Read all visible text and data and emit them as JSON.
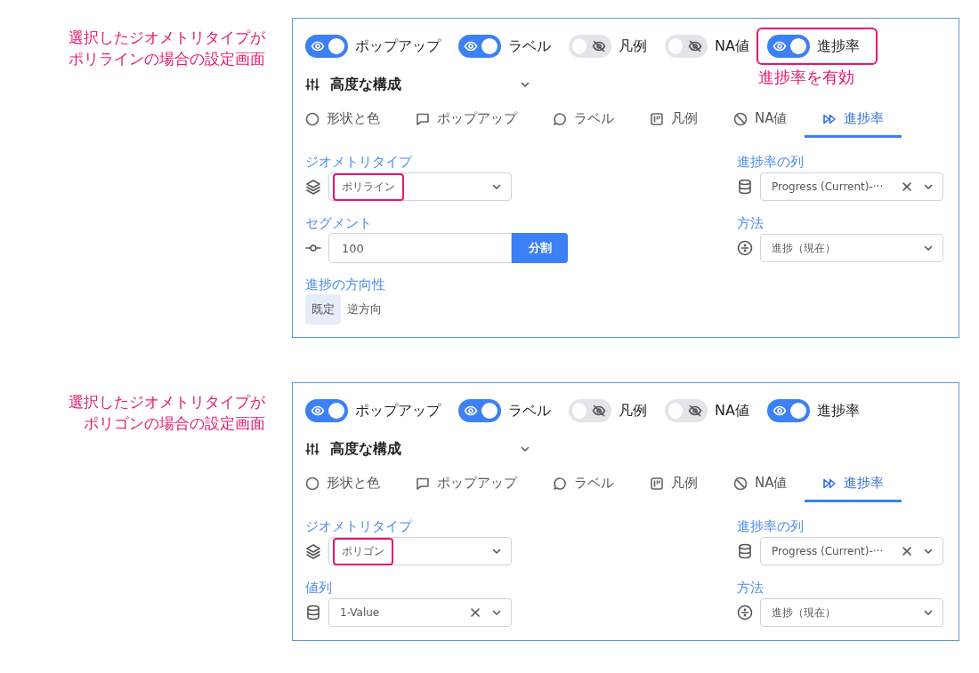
{
  "panels": [
    {
      "caption_lines": [
        "選択したジオメトリタイプが",
        "ポリラインの場合の設定画面"
      ],
      "toggles": [
        {
          "label": "ポップアップ",
          "on": true,
          "highlighted": false
        },
        {
          "label": "ラベル",
          "on": true,
          "highlighted": false
        },
        {
          "label": "凡例",
          "on": false,
          "highlighted": false
        },
        {
          "label": "NA値",
          "on": false,
          "highlighted": false
        },
        {
          "label": "進捗率",
          "on": true,
          "highlighted": true,
          "callout": "進捗率を有効"
        }
      ],
      "advanced": {
        "label": "高度な構成"
      },
      "tabs": [
        {
          "label": "形状と色",
          "selected": false
        },
        {
          "label": "ポップアップ",
          "selected": false
        },
        {
          "label": "ラベル",
          "selected": false
        },
        {
          "label": "凡例",
          "selected": false
        },
        {
          "label": "NA値",
          "selected": false
        },
        {
          "label": "進捗率",
          "selected": true
        }
      ],
      "left_fields": [
        {
          "kind": "geometry",
          "label": "ジオメトリタイプ",
          "value": "ポリライン",
          "clearable": false,
          "highlighted": true
        },
        {
          "kind": "number",
          "label": "セグメント",
          "value": "100",
          "button": "分割"
        },
        {
          "kind": "segmented",
          "label": "進捗の方向性",
          "options": [
            {
              "label": "既定",
              "selected": true
            },
            {
              "label": "逆方向",
              "selected": false
            }
          ]
        }
      ],
      "right_fields": [
        {
          "kind": "column",
          "label": "進捗率の列",
          "value": "Progress (Current)-···",
          "clearable": true,
          "highlighted": false
        },
        {
          "kind": "method",
          "label": "方法",
          "value": "進捗（現在）",
          "clearable": false,
          "highlighted": false
        }
      ]
    },
    {
      "caption_lines": [
        "選択したジオメトリタイプが",
        "ポリゴンの場合の設定画面"
      ],
      "toggles": [
        {
          "label": "ポップアップ",
          "on": true,
          "highlighted": false
        },
        {
          "label": "ラベル",
          "on": true,
          "highlighted": false
        },
        {
          "label": "凡例",
          "on": false,
          "highlighted": false
        },
        {
          "label": "NA値",
          "on": false,
          "highlighted": false
        },
        {
          "label": "進捗率",
          "on": true,
          "highlighted": false
        }
      ],
      "advanced": {
        "label": "高度な構成"
      },
      "tabs": [
        {
          "label": "形状と色",
          "selected": false
        },
        {
          "label": "ポップアップ",
          "selected": false
        },
        {
          "label": "ラベル",
          "selected": false
        },
        {
          "label": "凡例",
          "selected": false
        },
        {
          "label": "NA値",
          "selected": false
        },
        {
          "label": "進捗率",
          "selected": true
        }
      ],
      "left_fields": [
        {
          "kind": "geometry",
          "label": "ジオメトリタイプ",
          "value": "ポリゴン",
          "clearable": false,
          "highlighted": true
        },
        {
          "kind": "column",
          "label": "値列",
          "value": "1-Value",
          "clearable": true,
          "highlighted": false
        }
      ],
      "right_fields": [
        {
          "kind": "column",
          "label": "進捗率の列",
          "value": "Progress (Current)-···",
          "clearable": true,
          "highlighted": false
        },
        {
          "kind": "method",
          "label": "方法",
          "value": "進捗（現在）",
          "clearable": false,
          "highlighted": false
        }
      ]
    }
  ]
}
